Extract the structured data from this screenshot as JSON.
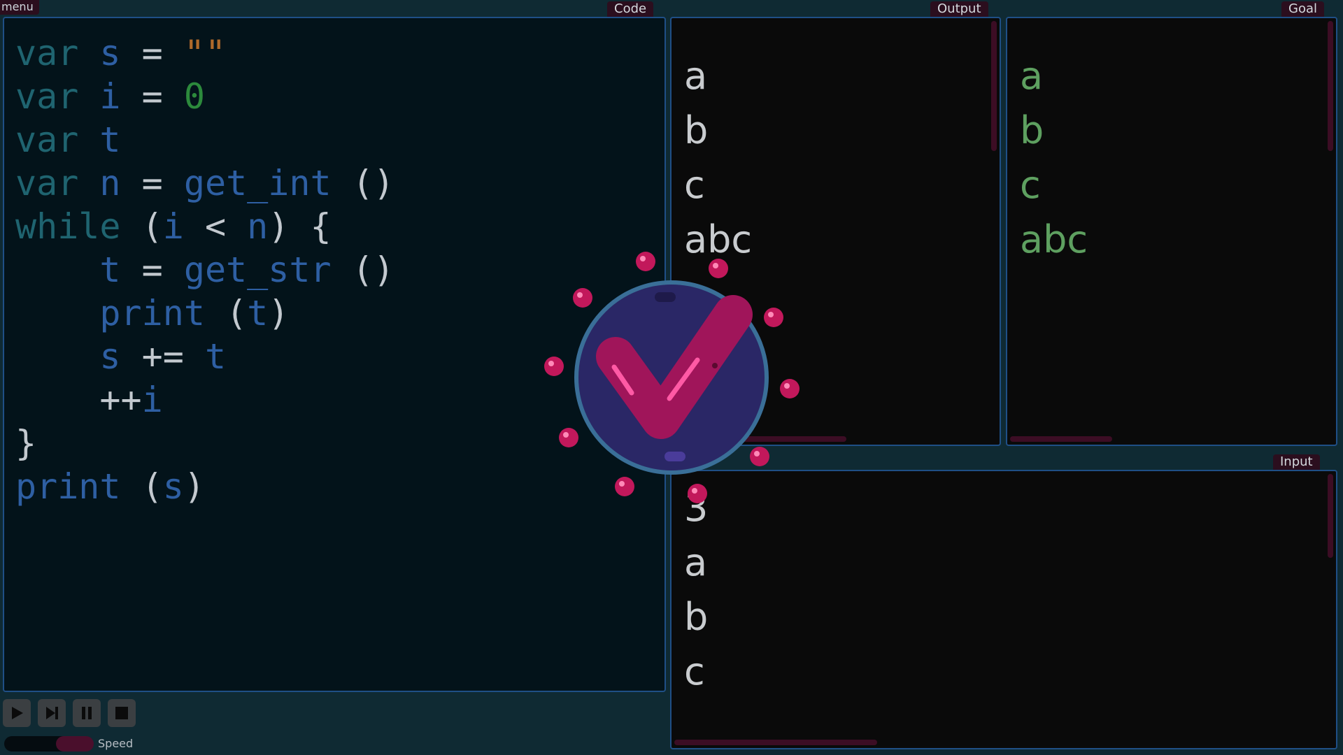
{
  "menu_label": "menu",
  "code_panel": {
    "tab_label": "Code",
    "lines": [
      [
        {
          "t": "var ",
          "c": "kw"
        },
        {
          "t": "s ",
          "c": "id"
        },
        {
          "t": "= ",
          "c": "op"
        },
        {
          "t": "\"\"",
          "c": "str"
        }
      ],
      [
        {
          "t": "var ",
          "c": "kw"
        },
        {
          "t": "i ",
          "c": "id"
        },
        {
          "t": "= ",
          "c": "op"
        },
        {
          "t": "0",
          "c": "num"
        }
      ],
      [
        {
          "t": "var ",
          "c": "kw"
        },
        {
          "t": "t",
          "c": "id"
        }
      ],
      [
        {
          "t": "var ",
          "c": "kw"
        },
        {
          "t": "n ",
          "c": "id"
        },
        {
          "t": "= ",
          "c": "op"
        },
        {
          "t": "get_int ",
          "c": "fn"
        },
        {
          "t": "()",
          "c": "op"
        }
      ],
      [
        {
          "t": "while ",
          "c": "kw"
        },
        {
          "t": "(",
          "c": "op"
        },
        {
          "t": "i ",
          "c": "id"
        },
        {
          "t": "< ",
          "c": "op"
        },
        {
          "t": "n",
          "c": "id"
        },
        {
          "t": ") {",
          "c": "op"
        }
      ],
      [
        {
          "t": "    t ",
          "c": "id"
        },
        {
          "t": "= ",
          "c": "op"
        },
        {
          "t": "get_str ",
          "c": "fn"
        },
        {
          "t": "()",
          "c": "op"
        }
      ],
      [
        {
          "t": "    print ",
          "c": "fn"
        },
        {
          "t": "(",
          "c": "op"
        },
        {
          "t": "t",
          "c": "id"
        },
        {
          "t": ")",
          "c": "op"
        }
      ],
      [
        {
          "t": "    s ",
          "c": "id"
        },
        {
          "t": "+= ",
          "c": "op"
        },
        {
          "t": "t",
          "c": "id"
        }
      ],
      [
        {
          "t": "    ++",
          "c": "op"
        },
        {
          "t": "i",
          "c": "id"
        }
      ],
      [
        {
          "t": "}",
          "c": "op"
        }
      ],
      [
        {
          "t": "print ",
          "c": "fn"
        },
        {
          "t": "(",
          "c": "op"
        },
        {
          "t": "s",
          "c": "id"
        },
        {
          "t": ")",
          "c": "op"
        }
      ]
    ]
  },
  "output_panel": {
    "tab_label": "Output",
    "lines": [
      "a",
      "b",
      "c",
      "abc"
    ]
  },
  "goal_panel": {
    "tab_label": "Goal",
    "lines": [
      "a",
      "b",
      "c",
      "abc"
    ]
  },
  "input_panel": {
    "tab_label": "Input",
    "lines": [
      "3",
      "a",
      "b",
      "c"
    ]
  },
  "controls": {
    "play_icon": "play-icon",
    "step_icon": "step-forward-icon",
    "pause_icon": "pause-icon",
    "stop_icon": "stop-icon",
    "speed_label": "Speed",
    "speed_level": 0.6
  },
  "success_badge": {
    "icon": "checkmark-icon",
    "colors": {
      "circle": "#2a2766",
      "ring": "#3a6f98",
      "check": "#a0155a",
      "particles": "#c2185b"
    }
  }
}
